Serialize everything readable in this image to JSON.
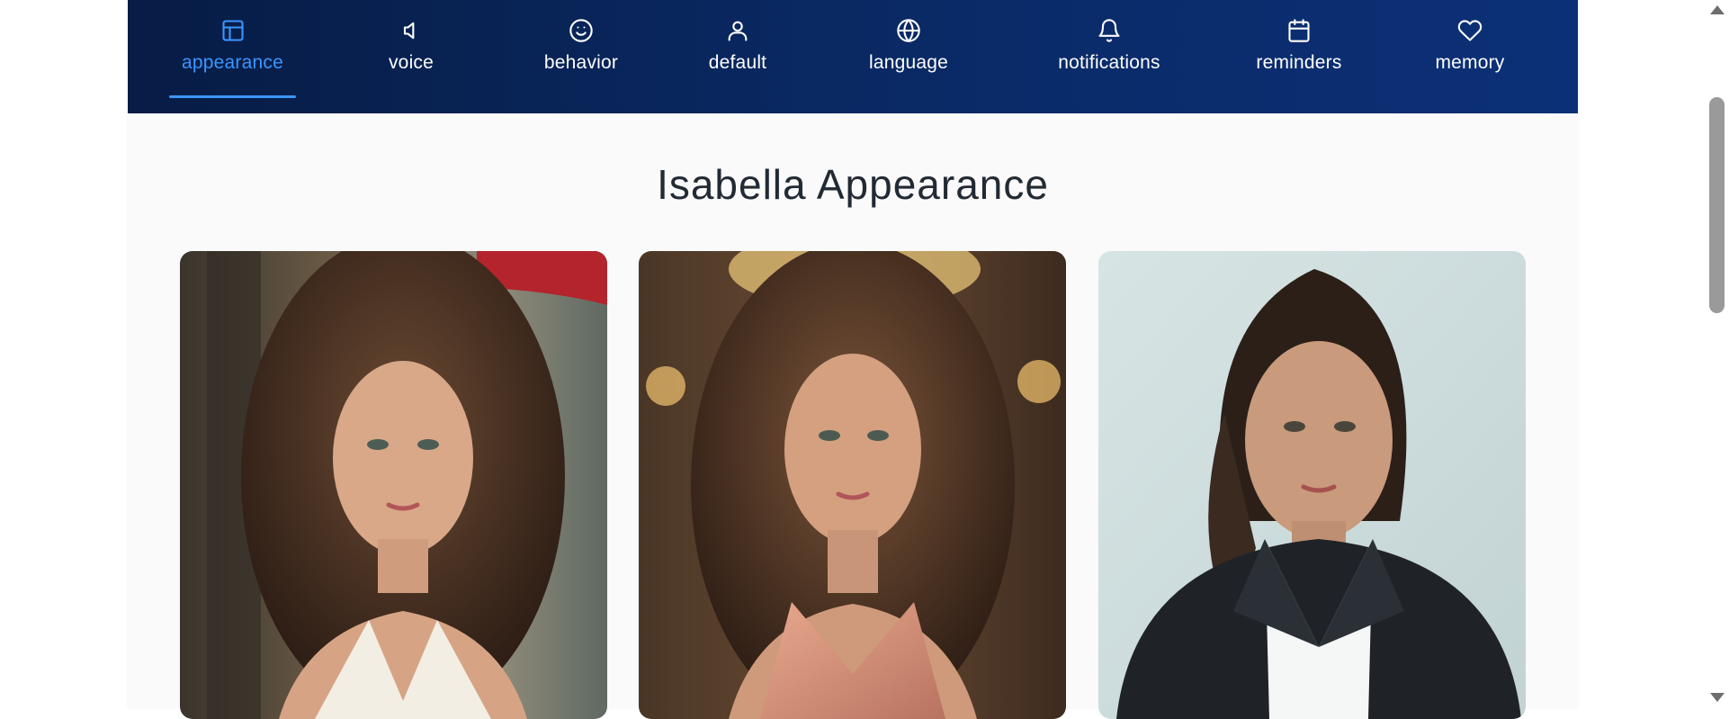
{
  "nav": {
    "items": [
      {
        "label": "appearance",
        "icon": "layout-icon",
        "active": true
      },
      {
        "label": "voice",
        "icon": "speaker-icon",
        "active": false
      },
      {
        "label": "behavior",
        "icon": "smile-icon",
        "active": false
      },
      {
        "label": "default",
        "icon": "user-icon",
        "active": false
      },
      {
        "label": "language",
        "icon": "globe-icon",
        "active": false
      },
      {
        "label": "notifications",
        "icon": "bell-icon",
        "active": false
      },
      {
        "label": "reminders",
        "icon": "calendar-icon",
        "active": false
      },
      {
        "label": "memory",
        "icon": "heart-icon",
        "active": false
      }
    ],
    "active_color": "#3b96ff"
  },
  "main": {
    "title": "Isabella Appearance",
    "images": [
      {
        "alt": "curly hair, white dress, cafe terrace"
      },
      {
        "alt": "curly hair, rose gold dress, chandelier room"
      },
      {
        "alt": "ponytail, black blazer, light background"
      }
    ]
  }
}
